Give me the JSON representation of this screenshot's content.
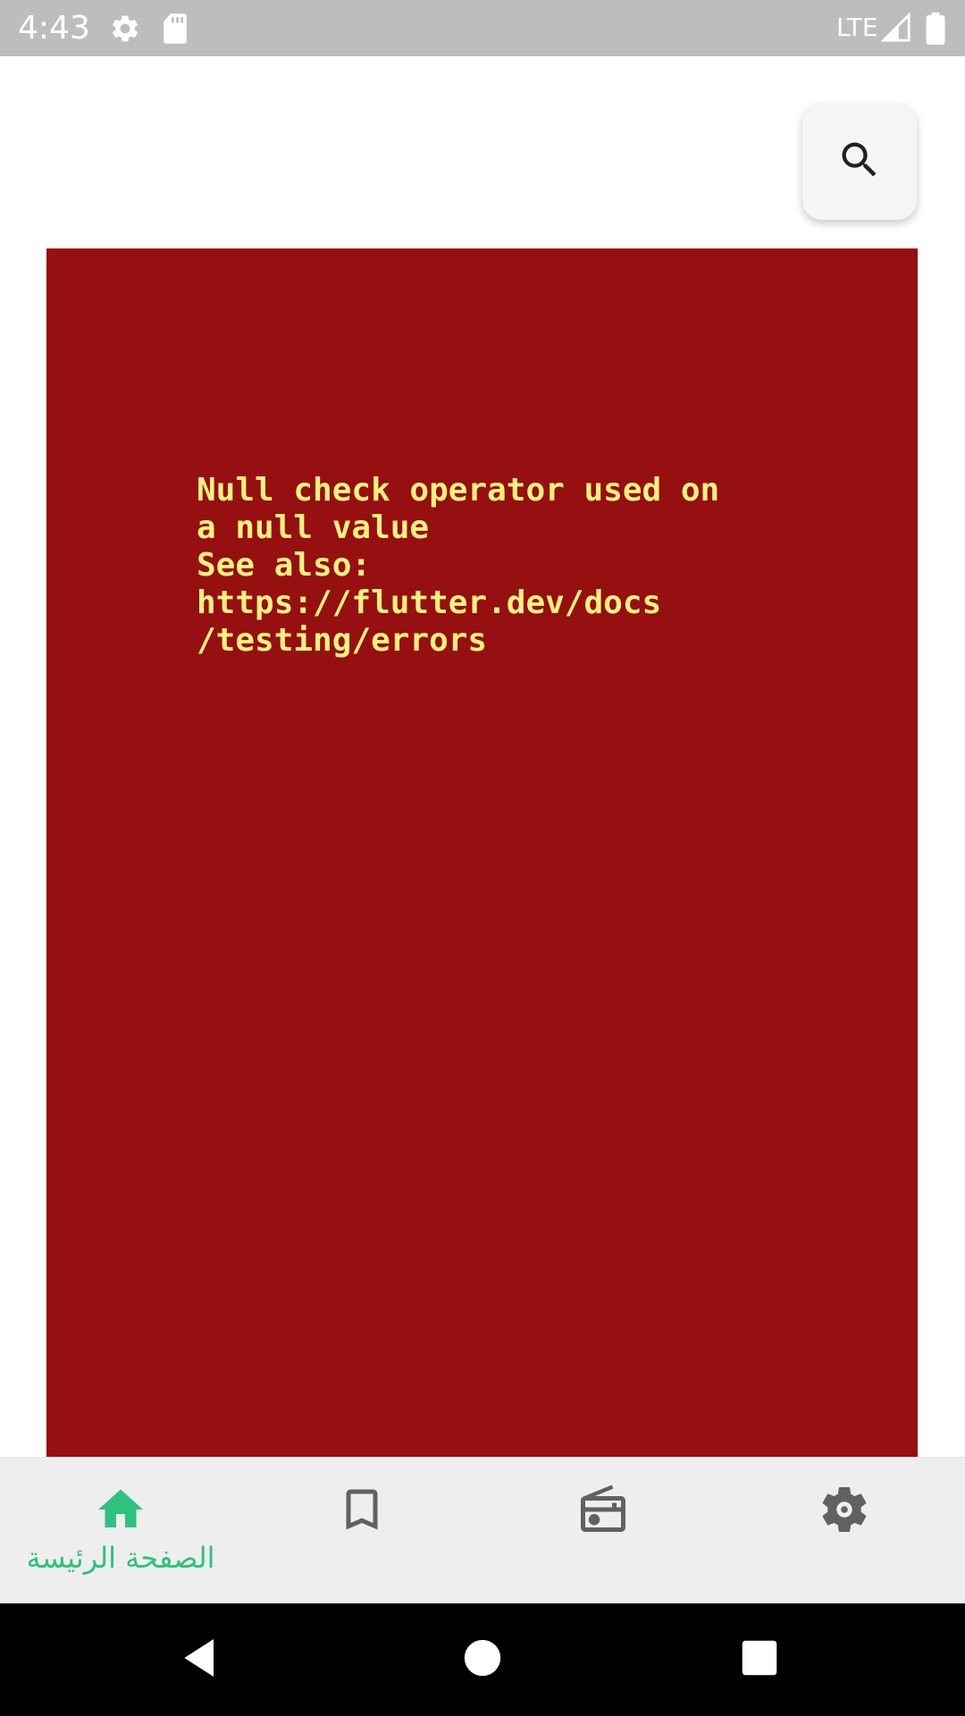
{
  "status_bar": {
    "time": "4:43",
    "network": "LTE",
    "icons": [
      "settings-icon",
      "sd-card-icon",
      "signal-icon",
      "battery-icon"
    ]
  },
  "search": {
    "icon": "search-icon"
  },
  "error": {
    "message": "Null check operator used on\na null value\nSee also:\nhttps://flutter.dev/docs\n/testing/errors",
    "background_color": "#960f11",
    "text_color": "#f7f180"
  },
  "bottom_nav": {
    "accent_color": "#2ec27e",
    "inactive_color": "#616161",
    "items": [
      {
        "icon": "home-icon",
        "label": "الصفحة الرئيسة",
        "active": true
      },
      {
        "icon": "bookmark-icon",
        "label": "",
        "active": false
      },
      {
        "icon": "radio-icon",
        "label": "",
        "active": false
      },
      {
        "icon": "settings-icon",
        "label": "",
        "active": false
      }
    ]
  },
  "system_nav": {
    "icons": [
      "back-icon",
      "home-circle-icon",
      "recents-icon"
    ]
  }
}
